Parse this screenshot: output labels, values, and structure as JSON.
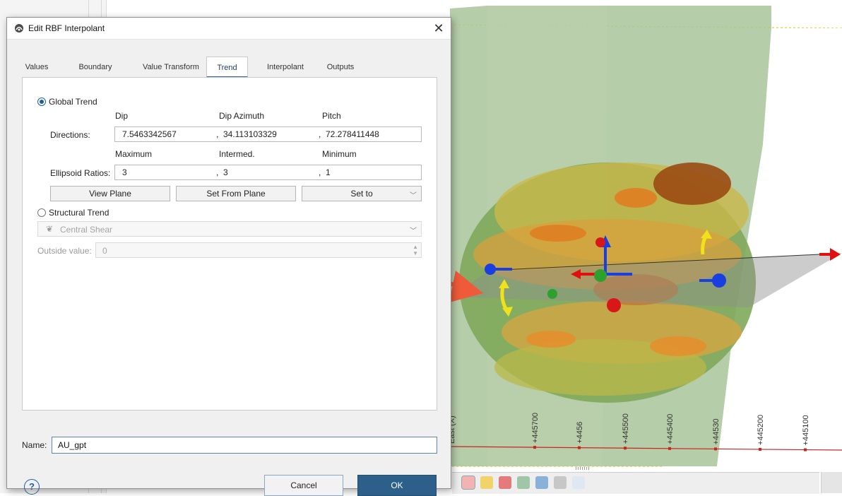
{
  "dialog": {
    "title": "Edit RBF Interpolant",
    "tabs": [
      {
        "label": "Values"
      },
      {
        "label": "Boundary"
      },
      {
        "label": "Value Transform"
      },
      {
        "label": "Trend",
        "active": true
      },
      {
        "label": "Interpolant"
      },
      {
        "label": "Outputs"
      }
    ],
    "global_trend_label": "Global Trend",
    "global_trend_selected": true,
    "direction_headers": [
      "Dip",
      "Dip Azimuth",
      "Pitch"
    ],
    "directions_label": "Directions:",
    "directions": [
      "7.5463342567",
      "34.113103329",
      "72.278411448"
    ],
    "ratio_headers": [
      "Maximum",
      "Intermed.",
      "Minimum"
    ],
    "ratios_label": "Ellipsoid Ratios:",
    "ratios": [
      "3",
      "3",
      "1"
    ],
    "separator": ",",
    "view_plane_button": "View Plane",
    "set_from_plane_button": "Set From Plane",
    "set_to_button": "Set to",
    "structural_trend_label": "Structural Trend",
    "structural_trend_selected": false,
    "structural_combo_value": "Central Shear",
    "outside_value_label": "Outside value:",
    "outside_value": "0",
    "name_label": "Name:",
    "name_value": "AU_gpt",
    "help_glyph": "?",
    "cancel_button": "Cancel",
    "ok_button": "OK"
  },
  "scene": {
    "axis_ticks": [
      "+445700",
      "+4456",
      "+445500",
      "+445400",
      "+44530",
      "+445200",
      "+445100"
    ],
    "axis_title": "East (X)"
  },
  "colors": {
    "accent": "#2c5f8a",
    "arrow": "#ef5a3a",
    "volume": "#a9c49a"
  },
  "icons": {
    "title": "rbf-interpolant-icon",
    "close": "close-icon",
    "help": "help-icon",
    "combo": "chevron-down-icon",
    "structural": "structural-trend-icon"
  }
}
